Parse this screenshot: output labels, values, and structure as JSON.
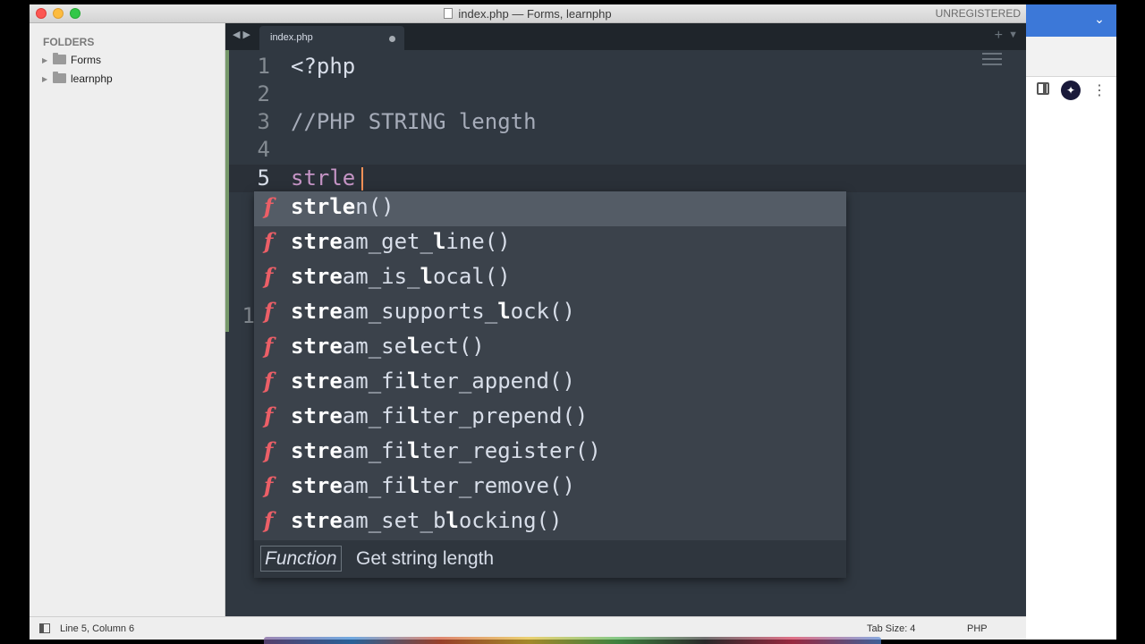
{
  "window": {
    "title": "index.php — Forms, learnphp",
    "registration": "UNREGISTERED"
  },
  "sidebar": {
    "heading": "FOLDERS",
    "folders": [
      {
        "label": "Forms"
      },
      {
        "label": "learnphp"
      }
    ]
  },
  "tabs": [
    {
      "label": "index.php",
      "dirty": true
    }
  ],
  "editor": {
    "lines": [
      {
        "number": "1",
        "text": "<?php"
      },
      {
        "number": "2",
        "text": ""
      },
      {
        "number": "3",
        "text": "//PHP STRING length"
      },
      {
        "number": "4",
        "text": ""
      },
      {
        "number": "5",
        "text": "strle"
      }
    ],
    "hidden_line_number": "1"
  },
  "autocomplete": {
    "kind_symbol": "f",
    "items": [
      {
        "parts": [
          {
            "t": "strle",
            "m": true
          },
          {
            "t": "n()",
            "m": false
          }
        ]
      },
      {
        "parts": [
          {
            "t": "stre",
            "m": true
          },
          {
            "t": "am_get_",
            "m": false
          },
          {
            "t": "l",
            "m": true
          },
          {
            "t": "ine()",
            "m": false
          }
        ]
      },
      {
        "parts": [
          {
            "t": "stre",
            "m": true
          },
          {
            "t": "am_is_",
            "m": false
          },
          {
            "t": "l",
            "m": true
          },
          {
            "t": "ocal()",
            "m": false
          }
        ]
      },
      {
        "parts": [
          {
            "t": "stre",
            "m": true
          },
          {
            "t": "am_supports_",
            "m": false
          },
          {
            "t": "l",
            "m": true
          },
          {
            "t": "ock()",
            "m": false
          }
        ]
      },
      {
        "parts": [
          {
            "t": "stre",
            "m": true
          },
          {
            "t": "am_se",
            "m": false
          },
          {
            "t": "l",
            "m": true
          },
          {
            "t": "ect()",
            "m": false
          }
        ]
      },
      {
        "parts": [
          {
            "t": "stre",
            "m": true
          },
          {
            "t": "am_fi",
            "m": false
          },
          {
            "t": "l",
            "m": true
          },
          {
            "t": "ter_append()",
            "m": false
          }
        ]
      },
      {
        "parts": [
          {
            "t": "stre",
            "m": true
          },
          {
            "t": "am_fi",
            "m": false
          },
          {
            "t": "l",
            "m": true
          },
          {
            "t": "ter_prepend()",
            "m": false
          }
        ]
      },
      {
        "parts": [
          {
            "t": "stre",
            "m": true
          },
          {
            "t": "am_fi",
            "m": false
          },
          {
            "t": "l",
            "m": true
          },
          {
            "t": "ter_register()",
            "m": false
          }
        ]
      },
      {
        "parts": [
          {
            "t": "stre",
            "m": true
          },
          {
            "t": "am_fi",
            "m": false
          },
          {
            "t": "l",
            "m": true
          },
          {
            "t": "ter_remove()",
            "m": false
          }
        ]
      },
      {
        "parts": [
          {
            "t": "stre",
            "m": true
          },
          {
            "t": "am_set_b",
            "m": false
          },
          {
            "t": "l",
            "m": true
          },
          {
            "t": "ocking()",
            "m": false
          }
        ]
      }
    ],
    "footer_kind": "Function",
    "footer_description": "Get string length"
  },
  "statusbar": {
    "position": "Line 5, Column 6",
    "tab_size": "Tab Size: 4",
    "syntax": "PHP"
  },
  "colors": {
    "editor_bg": "#303841",
    "tabbar_bg": "#1f252b",
    "kind_color": "#ec5f67",
    "typed_color": "#c594c5"
  }
}
